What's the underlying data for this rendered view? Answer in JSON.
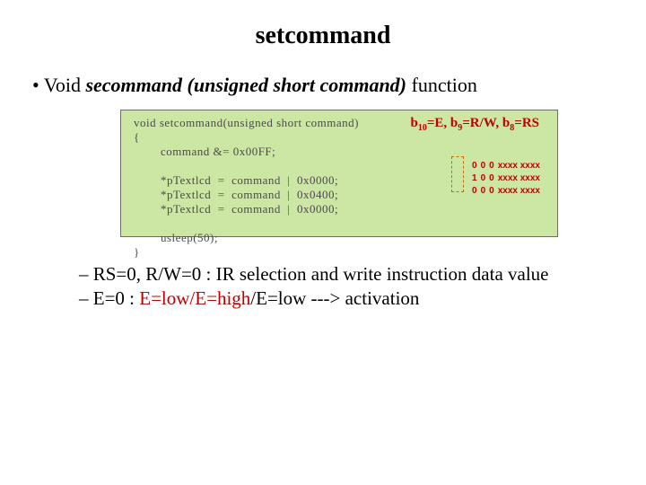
{
  "title": "setcommand",
  "bullet1_prefix": "•   Void ",
  "bullet1_italic": "secommand (unsigned short command)",
  "bullet1_suffix": " function",
  "code_text": "void setcommand(unsigned short command)\n{\n        command &= 0x00FF;\n\n        *pTextlcd  =  command  |  0x0000;\n        *pTextlcd  =  command  |  0x0400;\n        *pTextlcd  =  command  |  0x0000;\n\n        usleep(50);\n}",
  "bits_b10": "b",
  "bits_b10_sub": "10",
  "bits_b10_eq": "=E, ",
  "bits_b9": "b",
  "bits_b9_sub": "9",
  "bits_b9_eq": "=R/W, ",
  "bits_b8": "b",
  "bits_b8_sub": "8",
  "bits_b8_eq": "=RS",
  "bit_rows": [
    [
      "0",
      "0",
      "0",
      "xxxx xxxx"
    ],
    [
      "1",
      "0",
      "0",
      "xxxx xxxx"
    ],
    [
      "0",
      "0",
      "0",
      "xxxx xxxx"
    ]
  ],
  "sub1": "–   RS=0, R/W=0 : IR selection and write instruction data value",
  "sub2_prefix": "–   E=0 : ",
  "sub2_red": "E=low/E=high",
  "sub2_suffix": "/E=low ---> activation"
}
